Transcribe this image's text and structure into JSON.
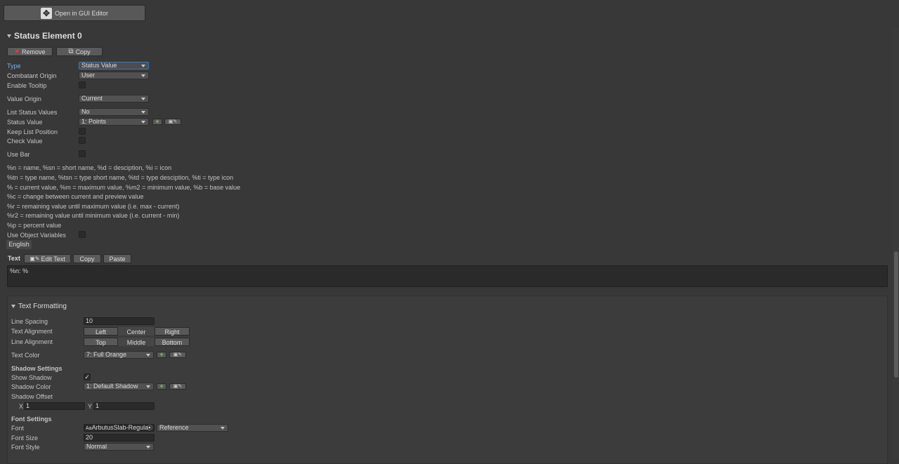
{
  "toolbar": {
    "open_gui_editor": "Open in GUI Editor"
  },
  "element": {
    "title": "Status Element 0",
    "remove": "Remove",
    "copy": "Copy"
  },
  "fields": {
    "type": {
      "label": "Type",
      "value": "Status Value"
    },
    "combatant_origin": {
      "label": "Combatant Origin",
      "value": "User"
    },
    "enable_tooltip": {
      "label": "Enable Tooltip"
    },
    "value_origin": {
      "label": "Value Origin",
      "value": "Current"
    },
    "list_status_values": {
      "label": "List Status Values",
      "value": "No"
    },
    "status_value": {
      "label": "Status Value",
      "value": "1: Points"
    },
    "keep_list_position": {
      "label": "Keep List Position"
    },
    "check_value": {
      "label": "Check Value"
    },
    "use_bar": {
      "label": "Use Bar"
    },
    "use_object_variables": {
      "label": "Use Object Variables"
    }
  },
  "help": [
    "%n = name, %sn = short name, %d = desciption, %i = icon",
    "%tn = type name, %tsn = type short name, %td = type desciption, %ti = type icon",
    "% = current value, %m = maximum value, %m2 = minimum value, %b = base value",
    "%c = change between current and preview value",
    "%r = remaining value until maximum value (i.e. max - current)",
    "%r2 = remaining value until minimum value (i.e. current - min)",
    "%p = percent value"
  ],
  "language_tab": "English",
  "text_section": {
    "label": "Text",
    "edit_text": "Edit Text",
    "copy": "Copy",
    "paste": "Paste",
    "value": "%n: %"
  },
  "formatting": {
    "title": "Text Formatting",
    "line_spacing": {
      "label": "Line Spacing",
      "value": "10"
    },
    "text_alignment": {
      "label": "Text Alignment",
      "options": [
        "Left",
        "Center",
        "Right"
      ],
      "selected": "Center"
    },
    "line_alignment": {
      "label": "Line Alignment",
      "options": [
        "Top",
        "Middle",
        "Bottom"
      ],
      "selected": "Middle"
    },
    "text_color": {
      "label": "Text Color",
      "value": "7: Full Orange"
    },
    "shadow_settings": "Shadow Settings",
    "show_shadow": {
      "label": "Show Shadow",
      "checked": "✓"
    },
    "shadow_color": {
      "label": "Shadow Color",
      "value": "1: Default Shadow"
    },
    "shadow_offset": {
      "label": "Shadow Offset",
      "x_label": "X",
      "x": "1",
      "y_label": "Y",
      "y": "1"
    },
    "font_settings": "Font Settings",
    "font": {
      "label": "Font",
      "value": "ArbutusSlab-Regula",
      "mode": "Reference"
    },
    "font_size": {
      "label": "Font Size",
      "value": "20"
    },
    "font_style": {
      "label": "Font Style",
      "value": "Normal"
    }
  },
  "colors": {
    "background": "#383838",
    "accent": "#3a79bb",
    "field": "#2a2a2a"
  }
}
